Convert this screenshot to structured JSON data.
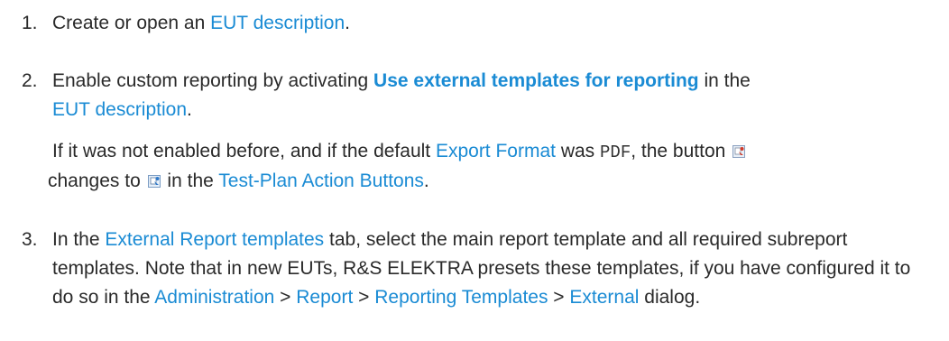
{
  "steps": [
    {
      "number": "1.",
      "before": "Create or open an ",
      "link": "EUT description",
      "after": "."
    },
    {
      "number": "2.",
      "line1_before": "Enable custom reporting by activating ",
      "line1_bold_link": "Use external templates for reporting",
      "line1_after": " in the ",
      "line2_link": "EUT description",
      "line2_after": ".",
      "p2_before": "If it was not enabled before, and if the default ",
      "p2_link1": "Export Format",
      "p2_mid1": " was ",
      "p2_code": "PDF",
      "p2_mid2": ", the button ",
      "p2_mid3": " changes to ",
      "p2_mid4": " in the ",
      "p2_link2": "Test-Plan Action Buttons",
      "p2_after": "."
    },
    {
      "number": "3.",
      "s_before": "In the ",
      "s_link1": "External Report templates",
      "s_mid1": " tab, select the main report template and all required subreport templates. Note that in new EUTs, R&S ELEKTRA presets these templates, if you have configured it to do so in the ",
      "s_link2": "Administration",
      "sep1": " > ",
      "s_link3": "Report",
      "sep2": " > ",
      "s_link4": "Reporting Templates",
      "sep3": " > ",
      "s_link5": "External",
      "s_after": " dialog."
    }
  ],
  "icons": {
    "pdf_export_button": "pdf-export-icon",
    "custom_export_button": "custom-export-icon"
  },
  "colors": {
    "link": "#1a8bd4",
    "text": "#2a2a2a"
  }
}
